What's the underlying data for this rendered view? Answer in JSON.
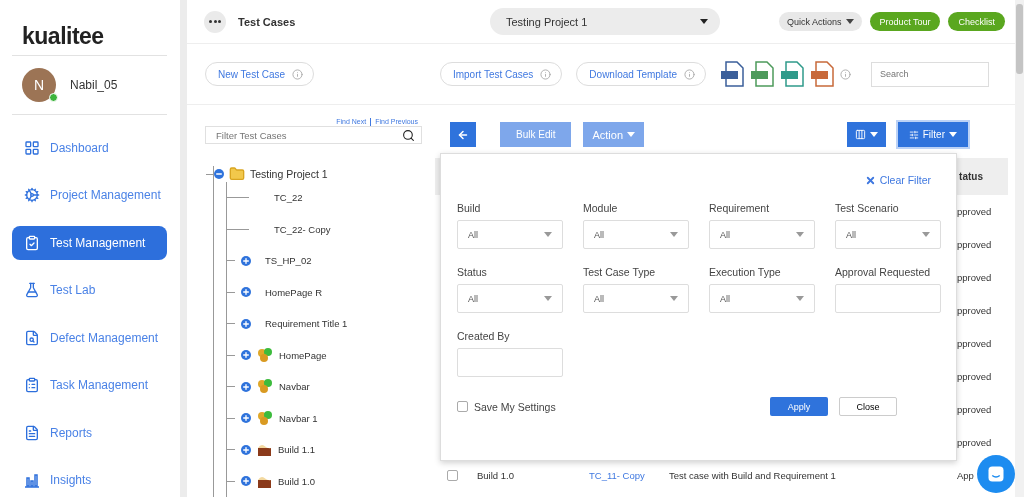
{
  "logo": {
    "text": "kualitee"
  },
  "user": {
    "initial": "N",
    "name": "Nabil_05",
    "online": true
  },
  "sidebar": {
    "items": [
      {
        "label": "Dashboard",
        "selected": false
      },
      {
        "label": "Project Management",
        "selected": false
      },
      {
        "label": "Test Management",
        "selected": true
      },
      {
        "label": "Test Lab",
        "selected": false
      },
      {
        "label": "Defect Management",
        "selected": false
      },
      {
        "label": "Task Management",
        "selected": false
      },
      {
        "label": "Reports",
        "selected": false
      },
      {
        "label": "Insights",
        "selected": false
      }
    ]
  },
  "header": {
    "title": "Test Cases",
    "project": "Testing Project 1",
    "quick_actions": "Quick Actions",
    "buttons": [
      "Product Tour",
      "Checklist"
    ]
  },
  "toolbar": {
    "new_button": "New Test Case",
    "import_button": "Import Test Cases",
    "download_button": "Download Template",
    "search": {
      "placeholder": "Search"
    }
  },
  "tree_panel": {
    "find_next": "Find Next",
    "find_previous": "Find Previous",
    "filter": {
      "placeholder": "Filter Test Cases"
    },
    "tree": [
      {
        "label": "Testing Project 1",
        "kind": "project",
        "expanded": true,
        "children": [
          {
            "label": "TC_22",
            "kind": "case"
          },
          {
            "label": "TC_22- Copy",
            "kind": "case"
          },
          {
            "label": "TS_HP_02",
            "kind": "scenario"
          },
          {
            "label": "HomePage R",
            "kind": "scenario"
          },
          {
            "label": "Requirement Title 1",
            "kind": "scenario"
          },
          {
            "label": "HomePage",
            "kind": "module"
          },
          {
            "label": "Navbar",
            "kind": "module"
          },
          {
            "label": "Navbar 1",
            "kind": "module"
          },
          {
            "label": "Build 1.1",
            "kind": "build"
          },
          {
            "label": "Build 1.0",
            "kind": "build"
          }
        ]
      }
    ]
  },
  "table_toolbar": {
    "bulk_edit": "Bulk Edit",
    "action": "Action",
    "filter": "Filter"
  },
  "table": {
    "status_header": "tatus",
    "rows": [
      {
        "status": "pproved"
      },
      {
        "status": "pproved"
      },
      {
        "status": "pproved"
      },
      {
        "status": "pproved"
      },
      {
        "status": "pproved"
      },
      {
        "status": "pproved"
      },
      {
        "status": "pproved"
      },
      {
        "status": "pproved"
      },
      {
        "checked": false,
        "build": "Build 1.0",
        "id": "TC_11- Copy",
        "description": "Test case with Build and Requirement 1",
        "status": "App"
      }
    ]
  },
  "filter_panel": {
    "clear": "Clear Filter",
    "fields": [
      {
        "label": "Build",
        "kind": "select",
        "value": "All"
      },
      {
        "label": "Module",
        "kind": "select",
        "value": "All"
      },
      {
        "label": "Requirement",
        "kind": "select",
        "value": "All"
      },
      {
        "label": "Test Scenario",
        "kind": "select",
        "value": "All"
      },
      {
        "label": "Status",
        "kind": "select",
        "value": "All"
      },
      {
        "label": "Test Case Type",
        "kind": "select",
        "value": "All"
      },
      {
        "label": "Execution Type",
        "kind": "select",
        "value": "All"
      },
      {
        "label": "Approval Requested",
        "kind": "text"
      },
      {
        "label": "Created By",
        "kind": "text"
      }
    ],
    "save_settings": {
      "label": "Save My Settings",
      "checked": false
    },
    "apply": "Apply",
    "close": "Close"
  }
}
